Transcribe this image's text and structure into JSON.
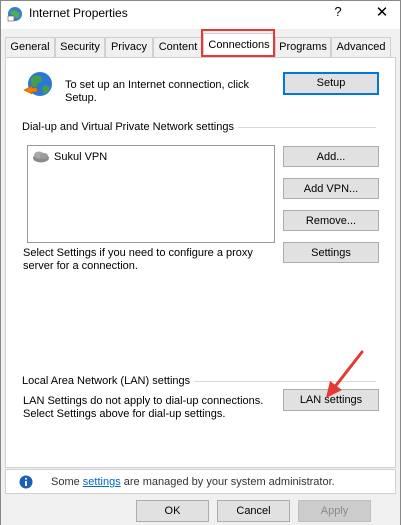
{
  "window": {
    "title": "Internet Properties",
    "help_glyph": "?",
    "close_glyph": "✕"
  },
  "tabs": [
    {
      "label": "General",
      "active": false
    },
    {
      "label": "Security",
      "active": false
    },
    {
      "label": "Privacy",
      "active": false
    },
    {
      "label": "Content",
      "active": false
    },
    {
      "label": "Connections",
      "active": true
    },
    {
      "label": "Programs",
      "active": false
    },
    {
      "label": "Advanced",
      "active": false
    }
  ],
  "setup": {
    "text": "To set up an Internet connection, click Setup.",
    "button": "Setup"
  },
  "vpn": {
    "section_label": "Dial-up and Virtual Private Network settings",
    "items": [
      {
        "label": "Sukul VPN"
      }
    ],
    "add_button": "Add...",
    "add_vpn_button": "Add VPN...",
    "remove_button": "Remove...",
    "settings_button": "Settings",
    "proxy_text": "Select Settings if you need to configure a proxy server for a connection."
  },
  "lan": {
    "section_label": "Local Area Network (LAN) settings",
    "text": "LAN Settings do not apply to dial-up connections. Select Settings above for dial-up settings.",
    "button": "LAN settings"
  },
  "info": {
    "prefix": "Some ",
    "link": "settings",
    "suffix": " are managed by your system administrator."
  },
  "footer": {
    "ok": "OK",
    "cancel": "Cancel",
    "apply": "Apply"
  },
  "colors": {
    "highlight": "#e53935",
    "accent": "#0078d7",
    "link": "#0066cc",
    "info_icon": "#1a5fb4"
  },
  "icons": {
    "window": "internet-options-icon",
    "setup": "globe-network-icon",
    "vpn_item": "vpn-connection-icon",
    "info": "info-icon"
  }
}
